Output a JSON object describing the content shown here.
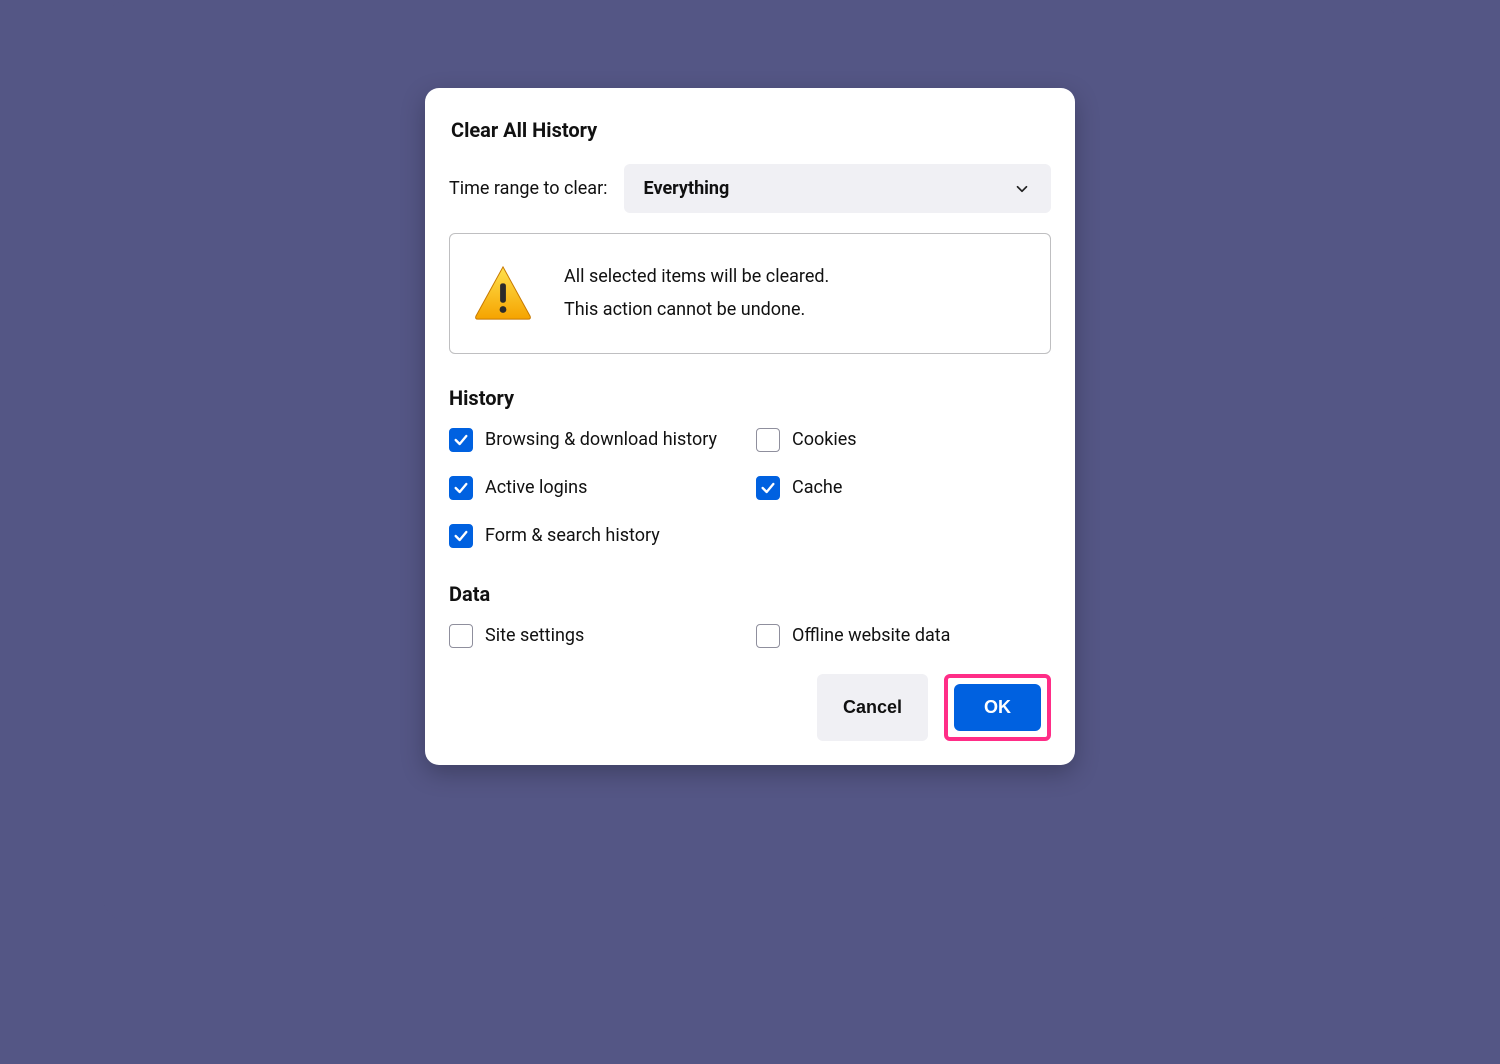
{
  "dialog": {
    "title": "Clear All History",
    "timeRange": {
      "label": "Time range to clear:",
      "value": "Everything"
    },
    "warning": {
      "line1": "All selected items will be cleared.",
      "line2": "This action cannot be undone."
    },
    "sections": {
      "history": {
        "heading": "History",
        "items": [
          {
            "label": "Browsing & download history",
            "checked": true
          },
          {
            "label": "Cookies",
            "checked": false
          },
          {
            "label": "Active logins",
            "checked": true
          },
          {
            "label": "Cache",
            "checked": true
          },
          {
            "label": "Form & search history",
            "checked": true
          }
        ]
      },
      "data": {
        "heading": "Data",
        "items": [
          {
            "label": "Site settings",
            "checked": false
          },
          {
            "label": "Offline website data",
            "checked": false
          }
        ]
      }
    },
    "buttons": {
      "cancel": "Cancel",
      "ok": "OK"
    }
  }
}
